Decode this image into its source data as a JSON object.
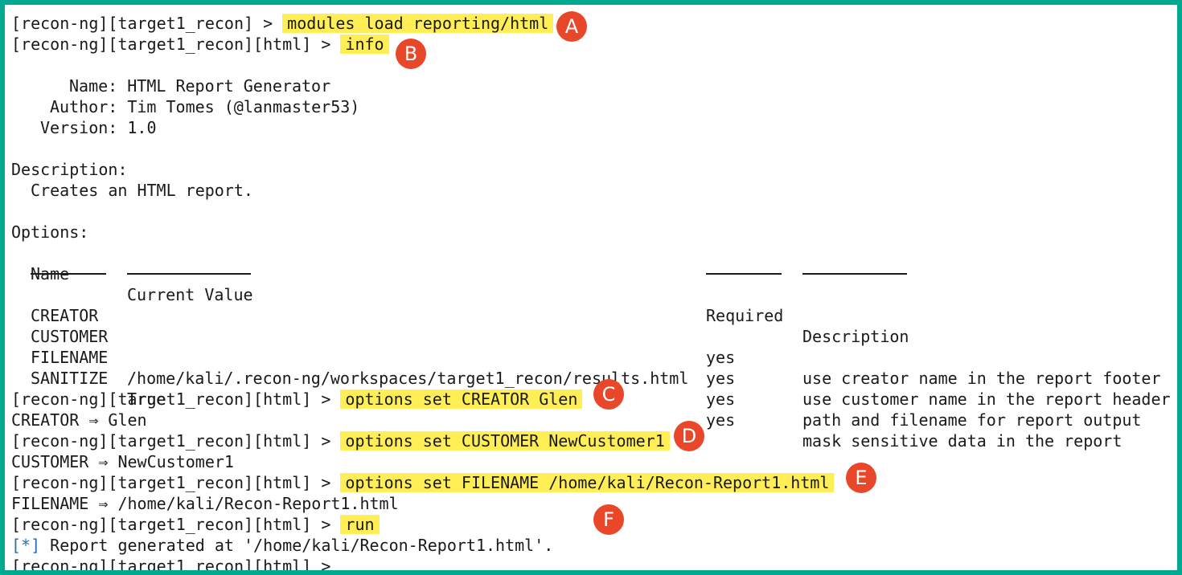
{
  "terminal": {
    "prompt_base": "[recon-ng][target1_recon] > ",
    "prompt_html": "[recon-ng][target1_recon][html] > ",
    "cmd_load": "modules load reporting/html",
    "cmd_info": "info",
    "meta": {
      "name_label": "Name:",
      "name_value": "HTML Report Generator",
      "author_label": "Author:",
      "author_value": "Tim Tomes (@lanmaster53)",
      "version_label": "Version:",
      "version_value": "1.0"
    },
    "description_label": "Description:",
    "description_text": "Creates an HTML report.",
    "options_label": "Options:",
    "options_headers": {
      "name": "Name",
      "value": "Current Value",
      "required": "Required",
      "description": "Description"
    },
    "options": [
      {
        "name": "CREATOR",
        "value": "",
        "required": "yes",
        "description": "use creator name in the report footer"
      },
      {
        "name": "CUSTOMER",
        "value": "",
        "required": "yes",
        "description": "use customer name in the report header"
      },
      {
        "name": "FILENAME",
        "value": "/home/kali/.recon-ng/workspaces/target1_recon/results.html",
        "required": "yes",
        "description": "path and filename for report output"
      },
      {
        "name": "SANITIZE",
        "value": "True",
        "required": "yes",
        "description": "mask sensitive data in the report"
      }
    ],
    "cmd_creator": "options set CREATOR Glen",
    "out_creator": "CREATOR ⇒ Glen",
    "cmd_customer": "options set CUSTOMER NewCustomer1",
    "out_customer": "CUSTOMER ⇒ NewCustomer1",
    "cmd_filename": "options set FILENAME /home/kali/Recon-Report1.html",
    "out_filename": "FILENAME ⇒ /home/kali/Recon-Report1.html",
    "cmd_run": "run",
    "out_run_bullet": "[*]",
    "out_run_text": " Report generated at '/home/kali/Recon-Report1.html'.",
    "last_prompt": "[recon-ng][target1_recon][html] >"
  },
  "badges": {
    "a": "A",
    "b": "B",
    "c": "C",
    "d": "D",
    "e": "E",
    "f": "F"
  },
  "colors": {
    "frame": "#00a98f",
    "highlight": "#ffee55",
    "badge": "#e8472a",
    "bullet": "#2a6fb5"
  }
}
